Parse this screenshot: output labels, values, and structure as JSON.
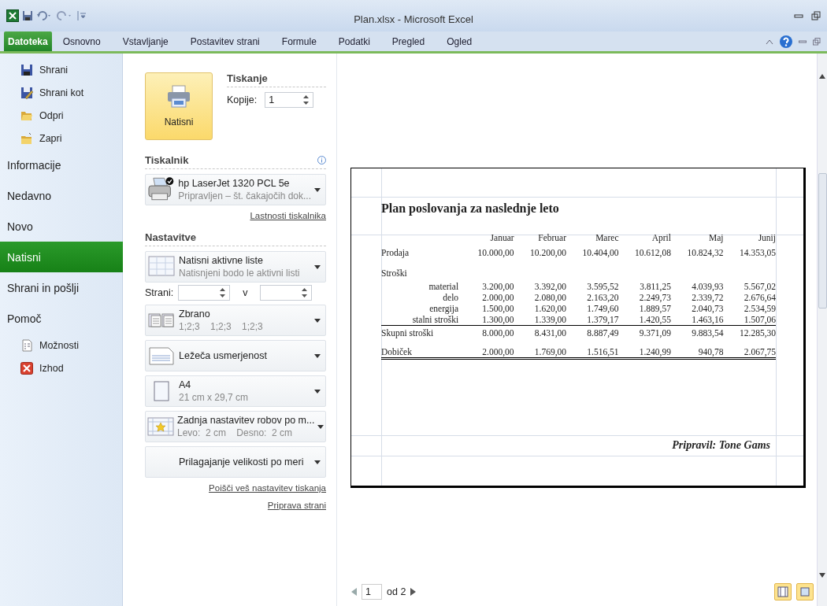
{
  "window": {
    "title": "Plan.xlsx  -  Microsoft Excel"
  },
  "ribbon_tabs": [
    {
      "label": "Datoteka",
      "selected": true
    },
    {
      "label": "Osnovno",
      "selected": false
    },
    {
      "label": "Vstavljanje",
      "selected": false
    },
    {
      "label": "Postavitev strani",
      "selected": false
    },
    {
      "label": "Formule",
      "selected": false
    },
    {
      "label": "Podatki",
      "selected": false
    },
    {
      "label": "Pregled",
      "selected": false
    },
    {
      "label": "Ogled",
      "selected": false
    }
  ],
  "sidebar": {
    "items": [
      {
        "label": "Shrani",
        "kind": "save",
        "selected": false
      },
      {
        "label": "Shrani kot",
        "kind": "saveas",
        "selected": false
      },
      {
        "label": "Odpri",
        "kind": "open",
        "selected": false
      },
      {
        "label": "Zapri",
        "kind": "close",
        "selected": false
      },
      {
        "label": "Informacije",
        "kind": "page",
        "selected": false
      },
      {
        "label": "Nedavno",
        "kind": "page",
        "selected": false
      },
      {
        "label": "Novo",
        "kind": "page",
        "selected": false
      },
      {
        "label": "Natisni",
        "kind": "page",
        "selected": true
      },
      {
        "label": "Shrani in pošlji",
        "kind": "page",
        "selected": false
      },
      {
        "label": "Pomoč",
        "kind": "page",
        "selected": false
      },
      {
        "label": "Možnosti",
        "kind": "options",
        "selected": false
      },
      {
        "label": "Izhod",
        "kind": "exit",
        "selected": false
      }
    ]
  },
  "print": {
    "button": "Natisni",
    "heading": "Tiskanje",
    "copies_label": "Kopije:",
    "copies": "1"
  },
  "printer": {
    "heading": "Tiskalnik",
    "name": "hp LaserJet 1320 PCL 5e",
    "status": "Pripravljen – št. čakajočih dok...",
    "link": "Lastnosti tiskalnika"
  },
  "settings": {
    "heading": "Nastavitve",
    "pages_label": "Strani:",
    "pages_to": "v",
    "options": [
      {
        "kind": "sheets",
        "title": "Natisni aktivne liste",
        "subtitle": "Natisnjeni bodo le aktivni listi"
      },
      {
        "kind": "collated",
        "title": "Zbrano",
        "subtitle": "1;2;3    1;2;3    1;2;3"
      },
      {
        "kind": "landscape",
        "title": "Ležeča usmerjenost"
      },
      {
        "kind": "paper",
        "title": "A4",
        "subtitle": "21 cm x 29,7 cm"
      },
      {
        "kind": "margins",
        "title": "Zadnja nastavitev robov po m...",
        "subtitle": "Levo:  2 cm    Desno:  2 cm"
      },
      {
        "kind": "scaling",
        "title": "Prilagajanje velikosti po meri"
      }
    ],
    "links": [
      "Poišči veš nastavitev tiskanja",
      "Priprava strani"
    ]
  },
  "preview": {
    "title": "Plan poslovanja za naslednje leto",
    "columns": [
      "Januar",
      "Februar",
      "Marec",
      "April",
      "Maj",
      "Junij"
    ],
    "rows": [
      {
        "kind": "item",
        "label": "Prodaja",
        "values": [
          "10.000,00",
          "10.200,00",
          "10.404,00",
          "10.612,08",
          "10.824,32",
          "14.353,05"
        ]
      },
      {
        "kind": "group",
        "label": "Stroški"
      },
      {
        "kind": "sub",
        "label": "material",
        "values": [
          "3.200,00",
          "3.392,00",
          "3.595,52",
          "3.811,25",
          "4.039,93",
          "5.567,02"
        ]
      },
      {
        "kind": "sub",
        "label": "delo",
        "values": [
          "2.000,00",
          "2.080,00",
          "2.163,20",
          "2.249,73",
          "2.339,72",
          "2.676,64"
        ]
      },
      {
        "kind": "sub",
        "label": "energija",
        "values": [
          "1.500,00",
          "1.620,00",
          "1.749,60",
          "1.889,57",
          "2.040,73",
          "2.534,59"
        ]
      },
      {
        "kind": "sub",
        "label": "stalni stroški",
        "values": [
          "1.300,00",
          "1.339,00",
          "1.379,17",
          "1.420,55",
          "1.463,16",
          "1.507,06"
        ]
      },
      {
        "kind": "total",
        "label": "Skupni stroški",
        "values": [
          "8.000,00",
          "8.431,00",
          "8.887,49",
          "9.371,09",
          "9.883,54",
          "12.285,30"
        ]
      },
      {
        "kind": "result",
        "label": "Dobiček",
        "values": [
          "2.000,00",
          "1.769,00",
          "1.516,51",
          "1.240,99",
          "940,78",
          "2.067,75"
        ]
      }
    ],
    "footer": "Pripravil:  Tone Gams"
  },
  "page_nav": {
    "page": "1",
    "of": "od 2"
  }
}
